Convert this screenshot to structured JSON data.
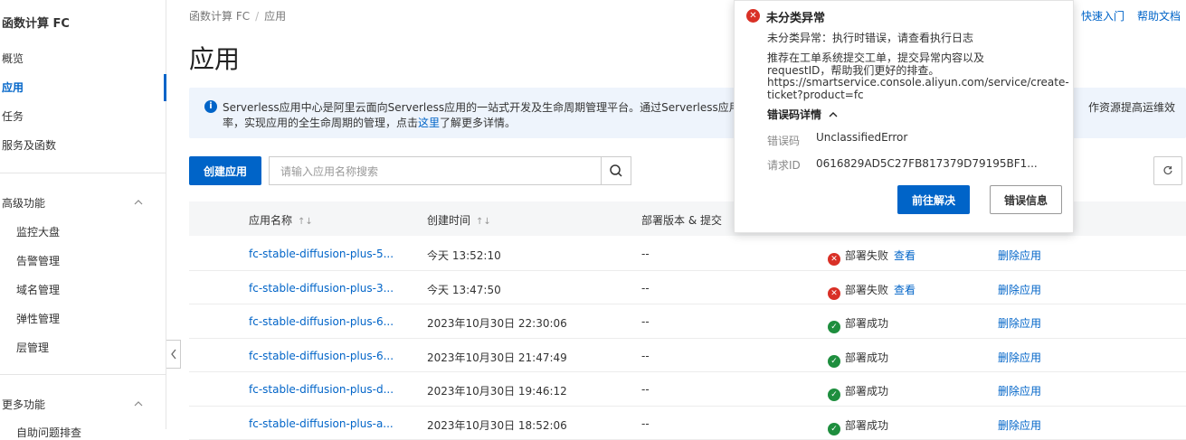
{
  "sidebar": {
    "title": "函数计算 FC",
    "items": [
      "概览",
      "应用",
      "任务",
      "服务及函数"
    ],
    "advanced_group": "高级功能",
    "advanced_items": [
      "监控大盘",
      "告警管理",
      "域名管理",
      "弹性管理",
      "层管理"
    ],
    "more_group": "更多功能",
    "more_partial": "自助问题排查"
  },
  "breadcrumb": [
    "函数计算 FC",
    "应用"
  ],
  "page_title": "应用",
  "top_links": [
    "快速入门",
    "帮助文档"
  ],
  "info": {
    "line1": "Serverless应用中心是阿里云面向Serverless应用的一站式开发及生命周期管理平台。通过Serverless应用中心",
    "line2_prefix": "率，实现应用的全生命周期的管理，点击",
    "line2_link": "这里",
    "line2_suffix": "了解更多详情。",
    "tail": "作资源提高运维效"
  },
  "toolbar": {
    "create_label": "创建应用",
    "search_placeholder": "请输入应用名称搜索"
  },
  "table": {
    "headers": [
      "应用名称",
      "创建时间",
      "部署版本 & 提交"
    ],
    "rows": [
      {
        "name": "fc-stable-diffusion-plus-5...",
        "time": "今天 13:52:10",
        "version": "--",
        "status": "部署失败",
        "status_type": "fail",
        "view": "查看",
        "action": "删除应用"
      },
      {
        "name": "fc-stable-diffusion-plus-3...",
        "time": "今天 13:47:50",
        "version": "--",
        "status": "部署失败",
        "status_type": "fail",
        "view": "查看",
        "action": "删除应用"
      },
      {
        "name": "fc-stable-diffusion-plus-6...",
        "time": "2023年10月30日 22:30:06",
        "version": "--",
        "status": "部署成功",
        "status_type": "ok",
        "view": "",
        "action": "删除应用"
      },
      {
        "name": "fc-stable-diffusion-plus-6...",
        "time": "2023年10月30日 21:47:49",
        "version": "--",
        "status": "部署成功",
        "status_type": "ok",
        "view": "",
        "action": "删除应用"
      },
      {
        "name": "fc-stable-diffusion-plus-d...",
        "time": "2023年10月30日 19:46:12",
        "version": "--",
        "status": "部署成功",
        "status_type": "ok",
        "view": "",
        "action": "删除应用"
      },
      {
        "name": "fc-stable-diffusion-plus-a...",
        "time": "2023年10月30日 18:52:06",
        "version": "--",
        "status": "部署成功",
        "status_type": "ok",
        "view": "",
        "action": "删除应用"
      }
    ]
  },
  "popup": {
    "title": "未分类异常",
    "message": "未分类异常：执行时错误，请查看执行日志",
    "suggest1": "推荐在工单系统提交工单，提交异常内容以及",
    "suggest2": "requestID，帮助我们更好的排查。",
    "url1": "https://smartservice.console.aliyun.com/service/create-",
    "url2": "ticket?product=fc",
    "detail_label": "错误码详情",
    "code_label": "错误码",
    "code_value": "UnclassifiedError",
    "request_label": "请求ID",
    "request_value": "0616829AD5C27FB817379D79195BF1...",
    "primary_label": "前往解决",
    "secondary_label": "错误信息"
  },
  "colors": {
    "accent": "#0064c8",
    "error": "#d93026",
    "success": "#1e8e3e"
  }
}
